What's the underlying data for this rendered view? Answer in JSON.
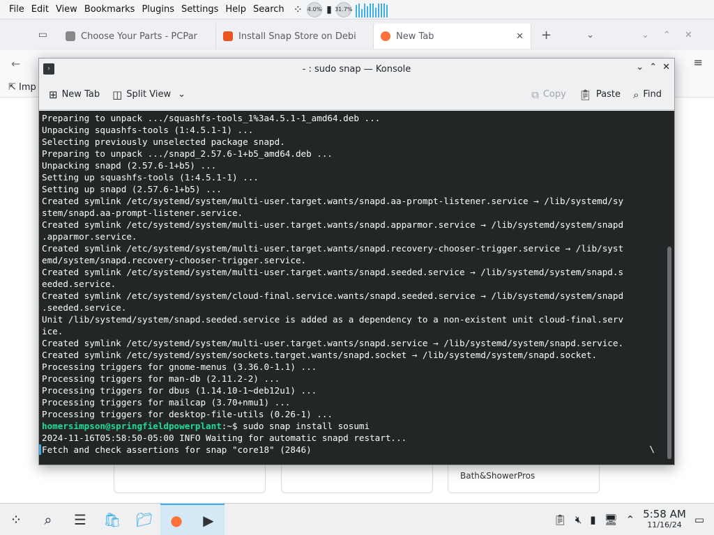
{
  "menubar": {
    "items": [
      "File",
      "Edit",
      "View",
      "Bookmarks",
      "Plugins",
      "Settings",
      "Help",
      "Search"
    ],
    "cpu": "4.0%",
    "mem": "31.7%"
  },
  "browser": {
    "tabs": [
      {
        "label": "Choose Your Parts - PCPar"
      },
      {
        "label": "Install Snap Store on Debi"
      },
      {
        "label": "New Tab"
      }
    ],
    "bookmark_label": "Imp",
    "card_text": "Bath&ShowerPros"
  },
  "konsole": {
    "title": "- : sudo snap — Konsole",
    "toolbar": {
      "new_tab": "New Tab",
      "split_view": "Split View",
      "copy": "Copy",
      "paste": "Paste",
      "find": "Find"
    },
    "lines": [
      "Preparing to unpack .../squashfs-tools_1%3a4.5.1-1_amd64.deb ...",
      "Unpacking squashfs-tools (1:4.5.1-1) ...",
      "Selecting previously unselected package snapd.",
      "Preparing to unpack .../snapd_2.57.6-1+b5_amd64.deb ...",
      "Unpacking snapd (2.57.6-1+b5) ...",
      "Setting up squashfs-tools (1:4.5.1-1) ...",
      "Setting up snapd (2.57.6-1+b5) ...",
      "Created symlink /etc/systemd/system/multi-user.target.wants/snapd.aa-prompt-listener.service → /lib/systemd/sy",
      "stem/snapd.aa-prompt-listener.service.",
      "Created symlink /etc/systemd/system/multi-user.target.wants/snapd.apparmor.service → /lib/systemd/system/snapd",
      ".apparmor.service.",
      "Created symlink /etc/systemd/system/multi-user.target.wants/snapd.recovery-chooser-trigger.service → /lib/syst",
      "emd/system/snapd.recovery-chooser-trigger.service.",
      "Created symlink /etc/systemd/system/multi-user.target.wants/snapd.seeded.service → /lib/systemd/system/snapd.s",
      "eeded.service.",
      "Created symlink /etc/systemd/system/cloud-final.service.wants/snapd.seeded.service → /lib/systemd/system/snapd",
      ".seeded.service.",
      "Unit /lib/systemd/system/snapd.seeded.service is added as a dependency to a non-existent unit cloud-final.serv",
      "ice.",
      "Created symlink /etc/systemd/system/multi-user.target.wants/snapd.service → /lib/systemd/system/snapd.service.",
      "Created symlink /etc/systemd/system/sockets.target.wants/snapd.socket → /lib/systemd/system/snapd.socket.",
      "Processing triggers for gnome-menus (3.36.0-1.1) ...",
      "Processing triggers for man-db (2.11.2-2) ...",
      "Processing triggers for dbus (1.14.10-1~deb12u1) ...",
      "Processing triggers for mailcap (3.70+nmu1) ...",
      "Processing triggers for desktop-file-utils (0.26-1) ..."
    ],
    "prompt_user": "homersimpson@springfieldpowerplant",
    "prompt_suffix": ":~$ sudo snap install sosumi",
    "after_lines": [
      "2024-11-16T05:58:50-05:00 INFO Waiting for automatic snapd restart...",
      "Fetch and check assertions for snap \"core18\" (2846)"
    ],
    "spinner": "\\"
  },
  "taskbar": {
    "time": "5:58 AM",
    "date": "11/16/24"
  }
}
